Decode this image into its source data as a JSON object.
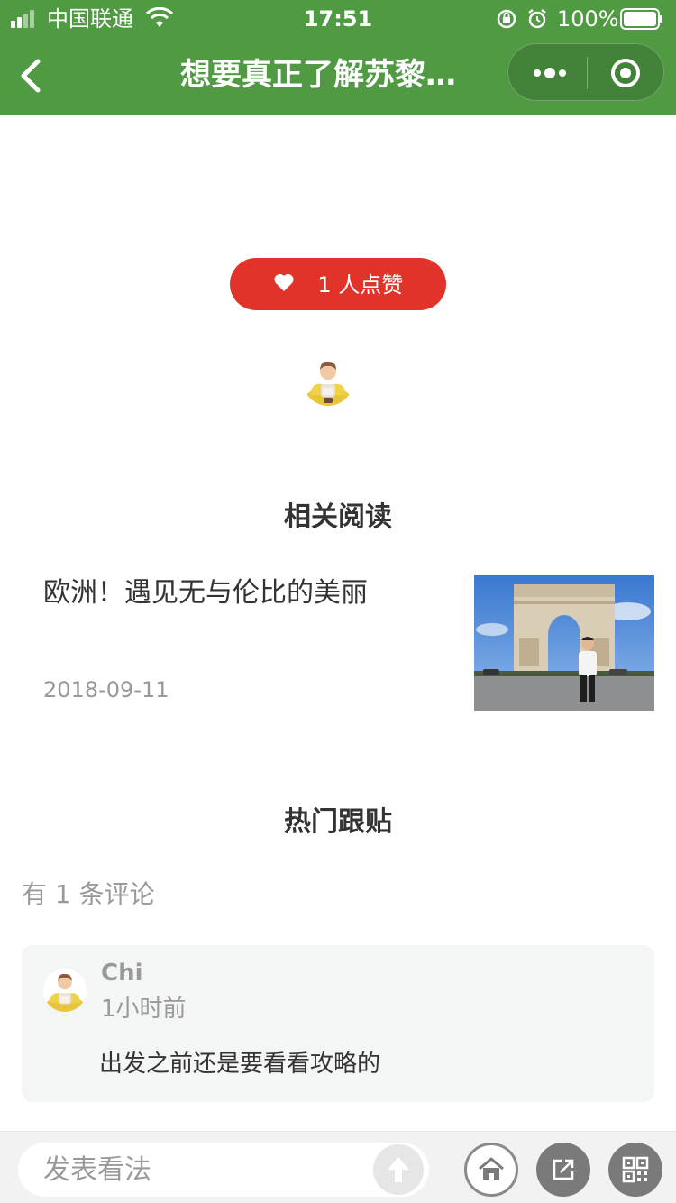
{
  "status_bar": {
    "carrier": "中国联通",
    "time": "17:51",
    "battery": "100%"
  },
  "nav": {
    "title": "想要真正了解苏黎…"
  },
  "like": {
    "label": "1 人点赞"
  },
  "related": {
    "heading": "相关阅读",
    "article": {
      "title": "欧洲！遇见无与伦比的美丽",
      "date": "2018-09-11"
    }
  },
  "comments": {
    "heading": "热门跟贴",
    "count_text": "有 1 条评论",
    "items": [
      {
        "name": "Chi",
        "time": "1小时前",
        "text": "出发之前还是要看看攻略的"
      }
    ]
  },
  "bottom_bar": {
    "input_placeholder": "发表看法"
  },
  "colors": {
    "nav_green": "#4f9a43",
    "like_red": "#e2332b"
  }
}
